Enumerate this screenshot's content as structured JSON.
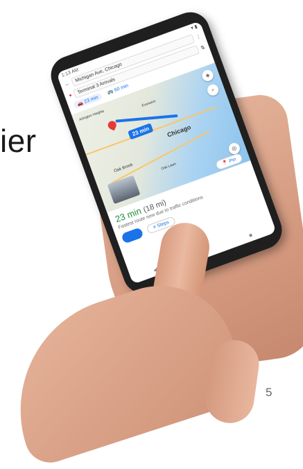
{
  "slide": {
    "partial_heading": "ier",
    "page_number": "5"
  },
  "phone": {
    "status_time": "1:13 AM",
    "status_right": "▾ ▮",
    "origin": "Michigan Ave, Chicago",
    "destination": "Terminal 3 Arrivals",
    "modes": [
      {
        "label": "23 min",
        "icon": "car-icon"
      },
      {
        "label": "60 min",
        "icon": "transit-icon"
      }
    ],
    "map": {
      "route_time": "23 min",
      "city_chicago": "Chicago",
      "city_oak_brook": "Oak Brook",
      "city_arlington": "Arlington Heights",
      "city_evanston": "Evanston",
      "city_oak_lawn": "Oak Lawn"
    },
    "eta": {
      "time": "23 min",
      "distance": "(18 mi)",
      "note": "Fastest route now due to traffic conditions"
    },
    "buttons": {
      "steps": "Steps",
      "pin": "Pin"
    }
  }
}
